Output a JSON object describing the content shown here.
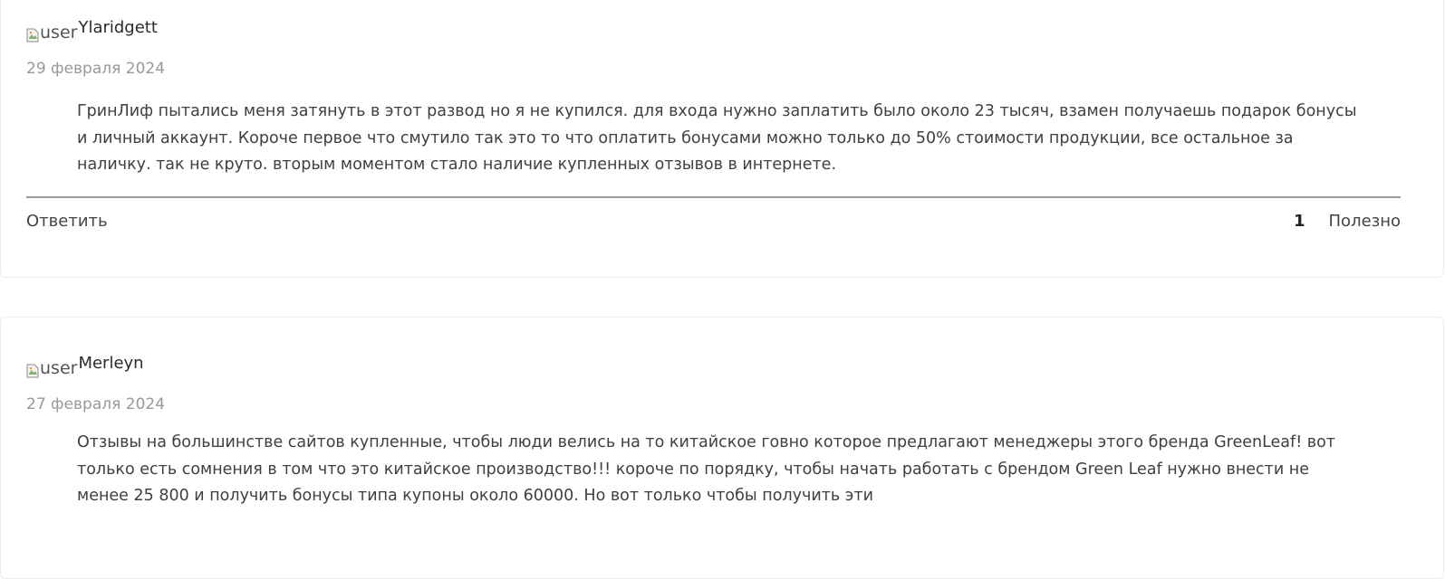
{
  "reviews": [
    {
      "avatar_alt": "user",
      "username": "Ylaridgett",
      "date": "29 февраля 2024",
      "text": "ГринЛиф пытались меня затянуть в этот развод но я не купился. для входа нужно заплатить было около 23 тысяч, взамен получаешь подарок бонусы и личный аккаунт. Короче первое что смутило так это то что оплатить бонусами можно только до 50% стоимости продукции, все остальное за наличку. так не круто. вторым моментом стало наличие купленных отзывов в интернете.",
      "reply_label": "Ответить",
      "helpful_count": "1",
      "helpful_label": "Полезно"
    },
    {
      "avatar_alt": "user",
      "username": "Merleyn",
      "date": "27 февраля 2024",
      "text": "Отзывы на большинстве сайтов купленные, чтобы люди велись на то китайское говно которое предлагают менеджеры этого бренда GreenLeaf! вот только есть сомнения в том что это китайское производство!!! короче по порядку, чтобы начать работать с брендом Green Leaf нужно внести не менее 25 800 и получить бонусы типа купоны около 60000. Но вот только чтобы получить эти"
    }
  ]
}
